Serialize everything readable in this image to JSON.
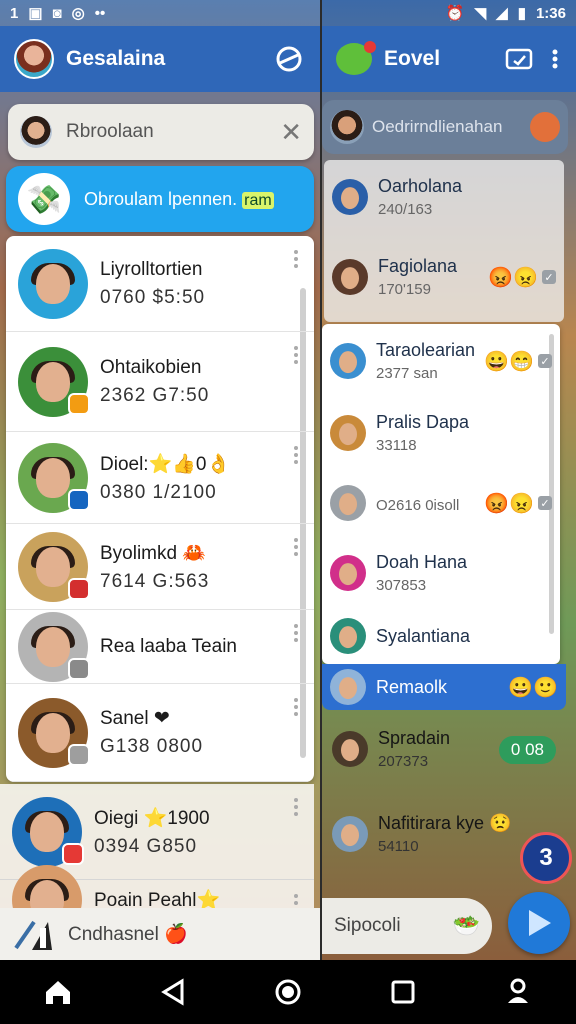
{
  "status_bar": {
    "left_text": "1",
    "time": "1:36",
    "icons_left": [
      "image-icon",
      "square-icon",
      "circle-o-icon",
      "dots-icon"
    ],
    "icons_right": [
      "alarm-icon",
      "wifi-icon",
      "signal-icon",
      "battery-icon"
    ]
  },
  "left_app": {
    "title": "Gesalaina",
    "search_value": "Rbroolaan",
    "promo_text": "Obroulam lpennen.",
    "promo_highlight": "ram",
    "chats": [
      {
        "name": "Liyrolltortien",
        "meta": "0760 $5:50",
        "avatar_bg": "#2aa3d9",
        "badge": ""
      },
      {
        "name": "Ohtaikobien",
        "meta": "2362 G7:50",
        "avatar_bg": "#3b8f3a",
        "badge": "#f39c12"
      },
      {
        "name": "Dioel:⭐👍0👌",
        "meta": "0380 1/2100",
        "avatar_bg": "#6aa84f",
        "badge": "#1565c0"
      },
      {
        "name": "Byolimkd 🦀",
        "meta": "7614 G:563",
        "avatar_bg": "#c9a25c",
        "badge": "#d32f2f"
      },
      {
        "name": "Rea laaba Teain",
        "meta": "",
        "avatar_bg": "#b4b4b4",
        "badge": "#8a8a8a"
      },
      {
        "name": "Sanel ❤",
        "meta": "G138 0800",
        "avatar_bg": "#8b5a2b",
        "badge": "#9e9e9e"
      }
    ],
    "outside_chats": [
      {
        "name": "Oiegi ⭐1900",
        "meta": "0394 G850",
        "avatar_bg": "#1e6fb8",
        "badge": "#e53935"
      },
      {
        "name": "Poain Peahl⭐",
        "meta": "",
        "avatar_bg": "#d89b6a",
        "badge": ""
      }
    ],
    "bottom_input_value": "Cndhasnel 🍎"
  },
  "right_app": {
    "title": "Eovel",
    "search_value": "Oedrirndlienahan",
    "top_chats": [
      {
        "name": "Oarholana",
        "meta": "240/163",
        "tags": ""
      },
      {
        "name": "Fagiolana",
        "meta": "170'159",
        "tags": "😡😠"
      }
    ],
    "card_chats": [
      {
        "name": "Taraolearian",
        "meta": "2377 san",
        "tags": "😀😁"
      },
      {
        "name": "Pralis Dapa",
        "meta": "33118",
        "tags": ""
      },
      {
        "name": "",
        "meta": "O2616 0isoll",
        "tags": "😡😠"
      },
      {
        "name": "Doah Hana",
        "meta": "307853",
        "tags": ""
      },
      {
        "name": "Syalantiana",
        "meta": "",
        "tags": ""
      }
    ],
    "selected_chat": {
      "name": "Remaolk",
      "tags": "😀🙂"
    },
    "bottom_chats": [
      {
        "name": "Spradain",
        "meta": "207373",
        "pill": "0 08"
      },
      {
        "name": "Nafitirara kye 😟",
        "meta": "54110",
        "pill": ""
      }
    ],
    "notif_count": "3",
    "input_value": "Sipocoli"
  },
  "nav": [
    "home-icon",
    "back-icon",
    "home-circle-icon",
    "recents-icon",
    "profile-icon"
  ],
  "colors": {
    "accent_blue": "#2f67b8",
    "promo_blue": "#22a5ee",
    "selected_blue": "#2d6fd0",
    "send_blue": "#2079d8",
    "pill_green": "#2e9c5c"
  }
}
